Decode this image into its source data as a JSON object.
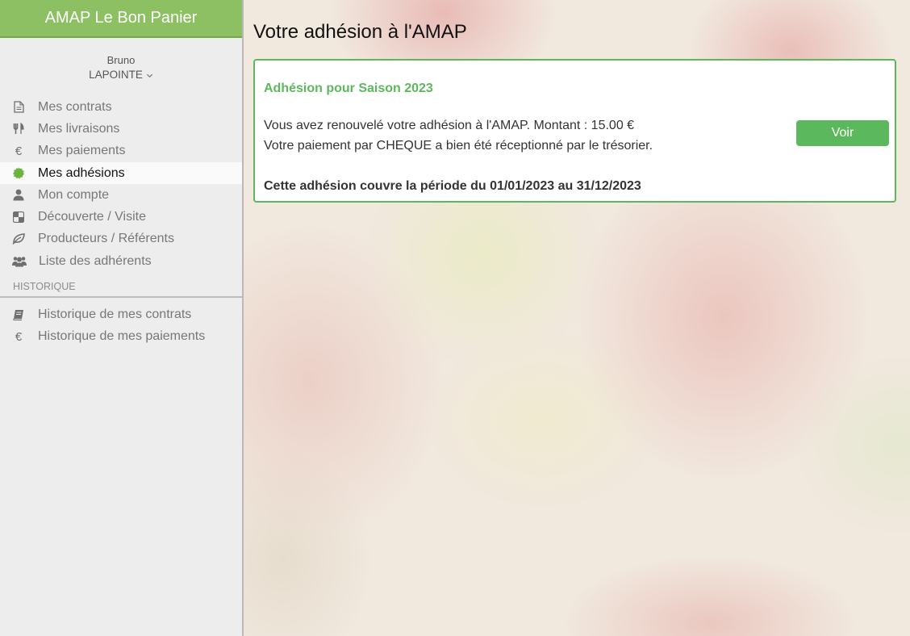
{
  "app": {
    "title": "AMAP Le Bon Panier"
  },
  "user": {
    "first_name": "Bruno",
    "last_name": "LAPOINTE"
  },
  "sidebar": {
    "items": [
      {
        "label": "Mes contrats",
        "icon": "file-icon"
      },
      {
        "label": "Mes livraisons",
        "icon": "utensils-icon"
      },
      {
        "label": "Mes paiements",
        "icon": "euro-icon"
      },
      {
        "label": "Mes adhésions",
        "icon": "badge-icon",
        "active": true
      },
      {
        "label": "Mon compte",
        "icon": "user-icon"
      },
      {
        "label": "Découverte / Visite",
        "icon": "checkerboard-icon"
      },
      {
        "label": "Producteurs / Référents",
        "icon": "leaf-icon"
      },
      {
        "label": "Liste des adhérents",
        "icon": "users-icon"
      }
    ],
    "history_title": "HISTORIQUE",
    "history_items": [
      {
        "label": "Historique de mes contrats",
        "icon": "book-icon"
      },
      {
        "label": "Historique de mes paiements",
        "icon": "euro-icon"
      }
    ]
  },
  "main": {
    "title": "Votre adhésion à l'AMAP",
    "card": {
      "title": "Adhésion pour Saison 2023",
      "line1": "Vous avez renouvelé votre adhésion à l'AMAP. Montant : 15.00 €",
      "line2": "Votre paiement par CHEQUE a bien été réceptionné par le trésorier.",
      "period": "Cette adhésion couvre la période du 01/01/2023 au 31/12/2023",
      "button_label": "Voir"
    }
  },
  "colors": {
    "brand": "#8cc063",
    "accent": "#5cb85c",
    "sidebar_bg": "#ededed"
  }
}
